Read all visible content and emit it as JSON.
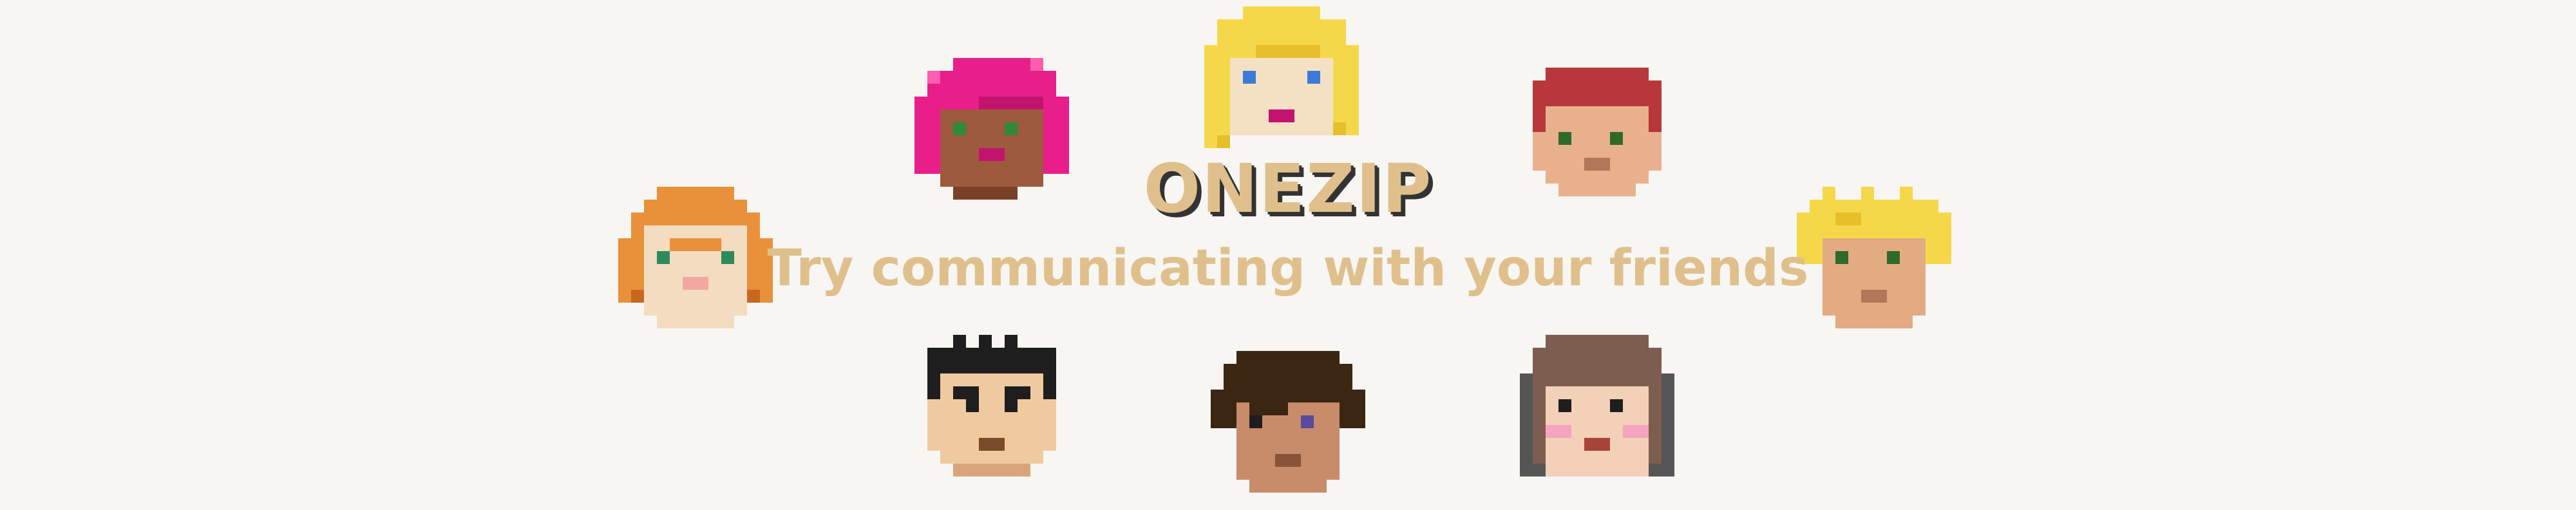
{
  "brand": {
    "title": "ONEZIP",
    "tagline": "Try communicating with your friends"
  },
  "colors": {
    "background": "#f7f6f3",
    "text_gold": "#dfc08c",
    "text_shadow": "#333333"
  },
  "avatars": [
    {
      "icon": "orange-hair-avatar-icon"
    },
    {
      "icon": "pink-hair-avatar-icon"
    },
    {
      "icon": "blonde-long-hair-avatar-icon"
    },
    {
      "icon": "red-hair-avatar-icon"
    },
    {
      "icon": "blonde-spiky-hair-avatar-icon"
    },
    {
      "icon": "black-spiky-hair-avatar-icon"
    },
    {
      "icon": "dark-brown-hair-avatar-icon"
    },
    {
      "icon": "brown-bob-hair-avatar-icon"
    }
  ]
}
